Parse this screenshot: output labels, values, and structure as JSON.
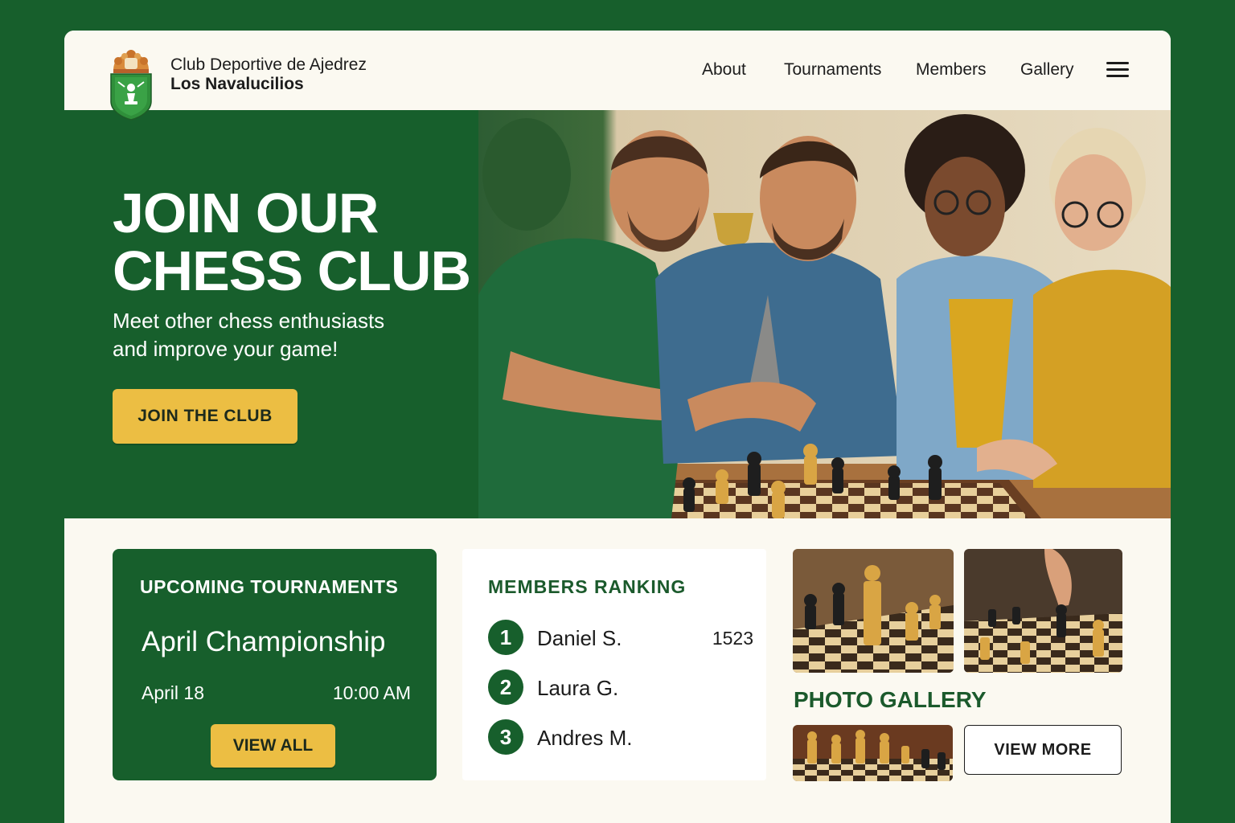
{
  "brand": {
    "line1": "Club Deportive de Ajedrez",
    "line2": "Los Navalucilios"
  },
  "nav": {
    "items": [
      "About",
      "Tournaments",
      "Members",
      "Gallery"
    ],
    "menu_icon": "hamburger-menu-icon"
  },
  "hero": {
    "title_line1": "JOIN OUR",
    "title_line2": "CHESS CLUB",
    "subtitle_line1": "Meet other chess enthusiasts",
    "subtitle_line2": "and improve your game!",
    "cta_label": "JOIN THE CLUB"
  },
  "tournaments": {
    "heading": "UPCOMING TOURNAMENTS",
    "event_name": "April Championship",
    "date": "April 18",
    "time": "10:00 AM",
    "button_label": "VIEW ALL"
  },
  "ranking": {
    "heading": "MEMBERS RANKING",
    "members": [
      {
        "rank": "1",
        "name": "Daniel S.",
        "score": "1523"
      },
      {
        "rank": "2",
        "name": "Laura G.",
        "score": ""
      },
      {
        "rank": "3",
        "name": "Andres M.",
        "score": ""
      }
    ]
  },
  "gallery": {
    "heading": "PHOTO GALLERY",
    "button_label": "VIEW MORE"
  },
  "colors": {
    "brand_green": "#175f2c",
    "accent_yellow": "#ecbe43",
    "page_background": "#fbf9f1"
  }
}
